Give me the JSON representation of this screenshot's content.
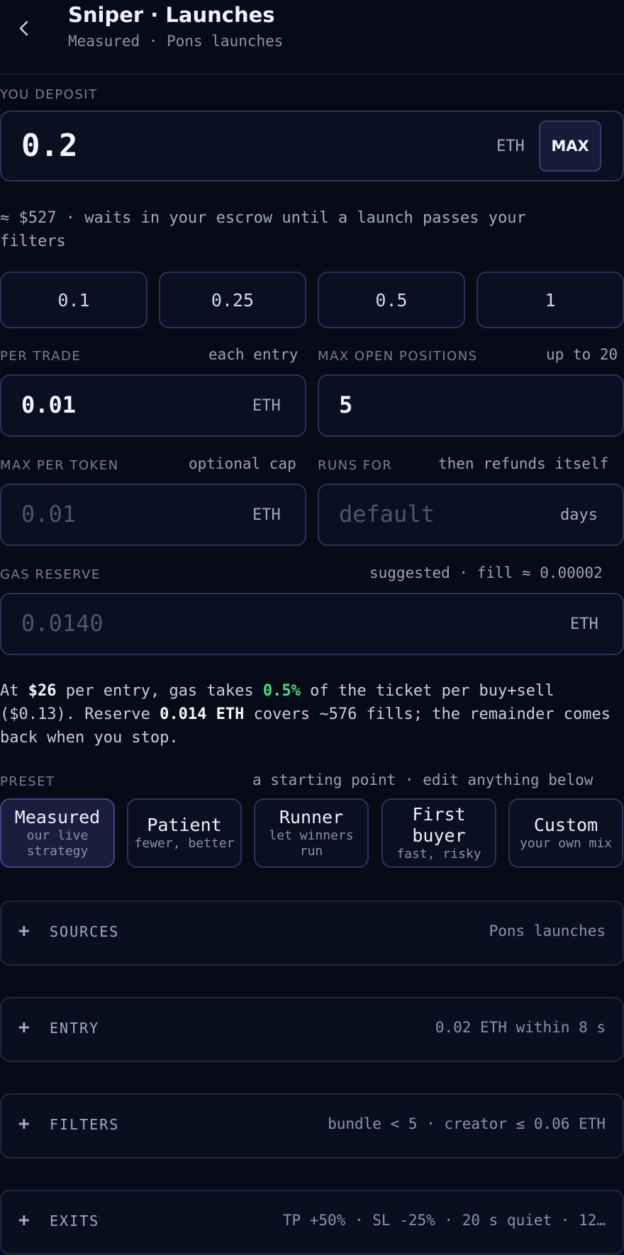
{
  "header": {
    "title": "Sniper · Launches",
    "subtitle": "Measured · Pons launches",
    "back_icon": "chevron-left-icon"
  },
  "deposit": {
    "label": "YOU DEPOSIT",
    "value": "0.2",
    "unit": "ETH",
    "max_label": "MAX",
    "note": "≈ $527 · waits in your escrow until a launch passes your filters"
  },
  "quick_amounts": [
    "0.1",
    "0.25",
    "0.5",
    "1"
  ],
  "per_trade": {
    "label": "PER TRADE",
    "hint": "each entry",
    "value": "0.01",
    "unit": "ETH"
  },
  "max_open": {
    "label": "MAX OPEN POSITIONS",
    "hint": "up to 20",
    "value": "5"
  },
  "max_per_token": {
    "label": "MAX PER TOKEN",
    "hint": "optional cap",
    "placeholder": "0.01",
    "unit": "ETH"
  },
  "runs_for": {
    "label": "RUNS FOR",
    "hint": "then refunds itself",
    "placeholder": "default",
    "unit": "days"
  },
  "gas_reserve": {
    "label": "GAS RESERVE",
    "hint": "suggested · fill ≈ 0.00002",
    "placeholder": "0.0140",
    "unit": "ETH"
  },
  "info": {
    "p1": "At ",
    "entry_amount": "$26",
    "p2": " per entry, gas takes ",
    "gas_pct": "0.5%",
    "p3": " of the ticket per buy+sell ($0.13). Reserve ",
    "reserve": "0.014 ETH",
    "p4": " covers ~576 fills; the remainder comes back when you stop."
  },
  "preset": {
    "label": "PRESET",
    "hint": "a starting point · edit anything below",
    "items": [
      {
        "name": "Measured",
        "desc": "our live strategy",
        "active": true
      },
      {
        "name": "Patient",
        "desc": "fewer, better",
        "active": false
      },
      {
        "name": "Runner",
        "desc": "let winners run",
        "active": false
      },
      {
        "name": "First buyer",
        "desc": "fast, risky",
        "active": false
      },
      {
        "name": "Custom",
        "desc": "your own mix",
        "active": false
      }
    ]
  },
  "sections": [
    {
      "name": "SOURCES",
      "value": "Pons launches"
    },
    {
      "name": "ENTRY",
      "value": "0.02 ETH within 8 s"
    },
    {
      "name": "FILTERS",
      "value": "bundle < 5 · creator ≤ 0.06 ETH"
    },
    {
      "name": "EXITS",
      "value": "TP +50% · SL -25% · 20 s quiet · 12…"
    }
  ],
  "colors": {
    "background": "#070b18",
    "accent_green": "#4ade80",
    "border": "#293256"
  }
}
